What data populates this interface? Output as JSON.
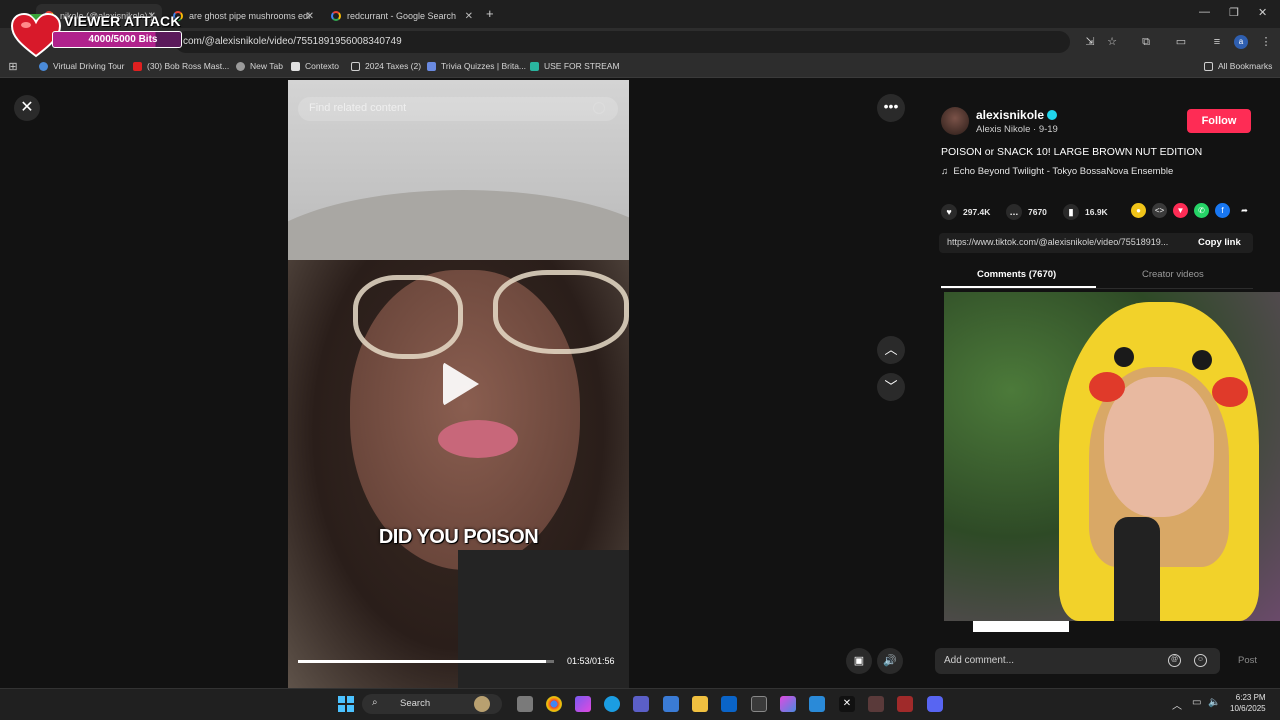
{
  "browser": {
    "tabs": [
      {
        "label": "nikole (@alexisnikole) |"
      },
      {
        "label": "are ghost pipe mushrooms edi"
      },
      {
        "label": "redcurrant - Google Search"
      }
    ],
    "url": "com/@alexisnikole/video/7551891956008340749",
    "bookmarks": [
      {
        "label": "Virtual Driving Tour"
      },
      {
        "label": "(30) Bob Ross Mast..."
      },
      {
        "label": "New Tab"
      },
      {
        "label": "Contexto"
      },
      {
        "label": "2024 Taxes (2)"
      },
      {
        "label": "Trivia Quizzes | Brita..."
      },
      {
        "label": "USE FOR STREAM"
      }
    ],
    "all_bookmarks": "All Bookmarks",
    "profile_initial": "a"
  },
  "overlay": {
    "title": "VIEWER ATTACK",
    "bits": "4000/5000 Bits",
    "progress": 0.8
  },
  "video": {
    "search_placeholder": "Find related content",
    "caption": "DID YOU POISON",
    "time": "01:53/01:56",
    "progress": 0.97
  },
  "panel": {
    "author": "alexisnikole",
    "author_sub": "Alexis Nikole · 9-19",
    "follow": "Follow",
    "description": "POISON or SNACK 10! LARGE BROWN NUT EDITION",
    "music": "Echo Beyond Twilight - Tokyo BossaNova Ensemble",
    "likes": "297.4K",
    "comments": "7670",
    "saves": "16.9K",
    "link": "https://www.tiktok.com/@alexisnikole/video/75518919...",
    "copy_link": "Copy link",
    "tab_comments": "Comments (7670)",
    "tab_creator": "Creator videos",
    "comment_placeholder": "Add comment...",
    "post": "Post"
  },
  "taskbar": {
    "search": "Search",
    "time": "6:23 PM",
    "date": "10/6/2025"
  },
  "colors": {
    "accent": "#fe2c55",
    "verified": "#20d5ec",
    "overlay_bar": "#b0228c"
  }
}
